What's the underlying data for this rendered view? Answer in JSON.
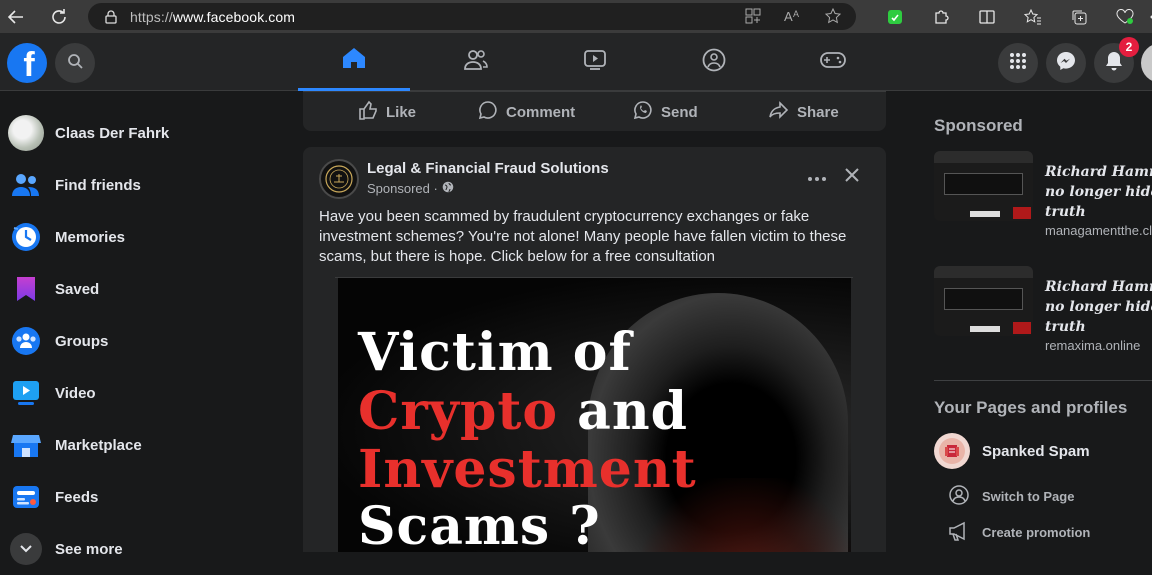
{
  "browser": {
    "url_protocol": "https://",
    "url_host": "www.facebook.com",
    "icons": [
      "back-icon",
      "reload-icon",
      "lock-icon",
      "app-grid-icon",
      "read-aloud-icon",
      "favorite-star-icon",
      "extension-green-icon",
      "extensions-puzzle-icon",
      "split-screen-icon",
      "favorites-icon",
      "collections-icon",
      "browser-health-icon",
      "more-icon"
    ]
  },
  "header": {
    "logo_letter": "f",
    "notification_count": "2",
    "colors": {
      "accent": "#2d88ff",
      "badge": "#e41e3f",
      "logo": "#1877f2"
    }
  },
  "left_nav": {
    "items": [
      {
        "label": "Claas Der Fahrk",
        "icon": "profile-avatar"
      },
      {
        "label": "Find friends",
        "icon": "friends-icon"
      },
      {
        "label": "Memories",
        "icon": "memories-clock-icon"
      },
      {
        "label": "Saved",
        "icon": "saved-bookmark-icon"
      },
      {
        "label": "Groups",
        "icon": "groups-icon"
      },
      {
        "label": "Video",
        "icon": "video-icon"
      },
      {
        "label": "Marketplace",
        "icon": "marketplace-icon"
      },
      {
        "label": "Feeds",
        "icon": "feeds-icon"
      },
      {
        "label": "See more",
        "icon": "chevron-down-icon"
      }
    ]
  },
  "action_bar": {
    "like": "Like",
    "comment": "Comment",
    "send": "Send",
    "share": "Share"
  },
  "post": {
    "author": "Legal & Financial Fraud Solutions",
    "meta": "Sponsored ·",
    "text": "Have you been scammed by fraudulent cryptocurrency exchanges or fake investment schemes? You're not alone! Many people have fallen victim to these scams, but there is hope. Click below for a free consultation",
    "image": {
      "line1a": "Victim",
      "line1b": "of",
      "line2a": "Crypto",
      "line2b": "and",
      "line3": "Investment",
      "line4": "Scams ?"
    }
  },
  "right_col": {
    "sponsored_heading": "Sponsored",
    "ads": [
      {
        "title_line1": "Richard Hammo",
        "title_line2": "no longer hides",
        "title_line3": "truth",
        "domain": "managamentthe.cl"
      },
      {
        "title_line1": "Richard Hammo",
        "title_line2": "no longer hides",
        "title_line3": "truth",
        "domain": "remaxima.online"
      }
    ],
    "pages_heading": "Your Pages and profiles",
    "page_name": "Spanked Spam",
    "switch_label": "Switch to Page",
    "promo_label": "Create promotion"
  }
}
